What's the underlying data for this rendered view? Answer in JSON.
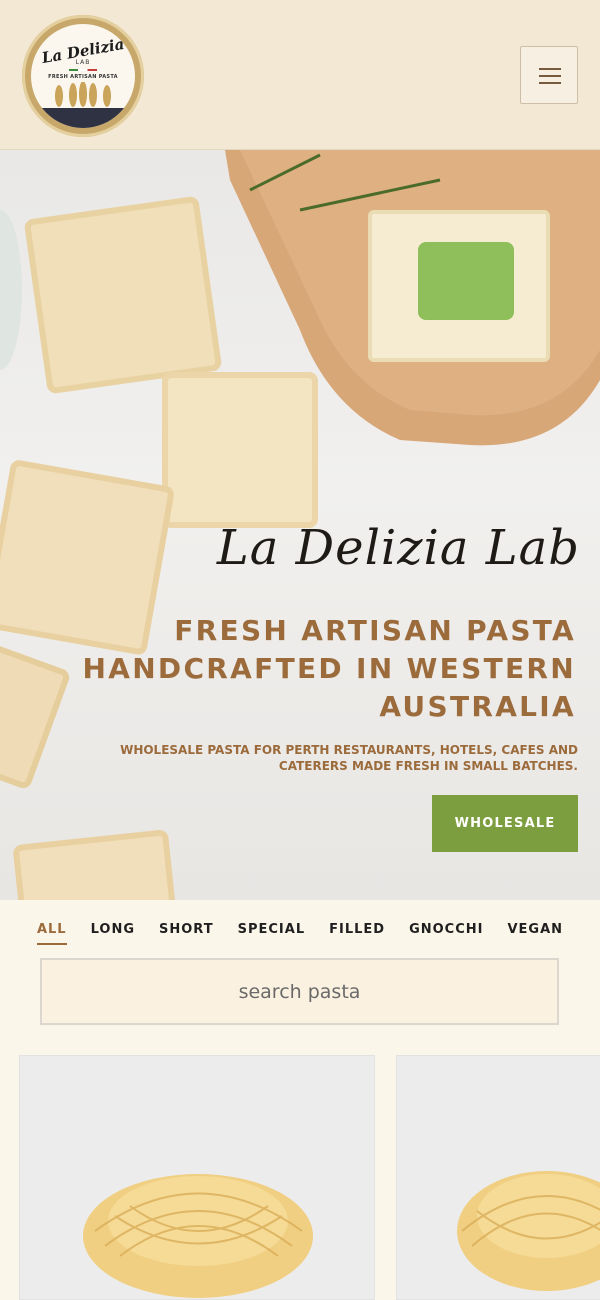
{
  "brand": {
    "logo_script": "La Delizia",
    "logo_lab": "LAB",
    "logo_tagline": "FRESH ARTISAN PASTA",
    "logo_alt": "La Delizia Lab logo"
  },
  "header": {
    "menu_icon": "hamburger-icon"
  },
  "hero": {
    "script_title": "La Delizia Lab",
    "headline": "FRESH ARTISAN PASTA HANDCRAFTED IN WESTERN AUSTRALIA",
    "subheadline": "WHOLESALE PASTA FOR PERTH RESTAURANTS, HOTELS, CAFES AND CATERERS MADE FRESH IN SMALL BATCHES.",
    "cta_label": "WHOLESALE"
  },
  "filters": {
    "tabs": [
      {
        "label": "ALL",
        "active": true
      },
      {
        "label": "LONG",
        "active": false
      },
      {
        "label": "SHORT",
        "active": false
      },
      {
        "label": "SPECIAL",
        "active": false
      },
      {
        "label": "FILLED",
        "active": false
      },
      {
        "label": "GNOCCHI",
        "active": false
      },
      {
        "label": "VEGAN",
        "active": false
      }
    ],
    "search_placeholder": "search pasta"
  },
  "colors": {
    "header_bg": "#f3e8d4",
    "accent_brown": "#9c6b3c",
    "cta_green": "#7d9e3e",
    "page_bg": "#fbf6ea"
  }
}
